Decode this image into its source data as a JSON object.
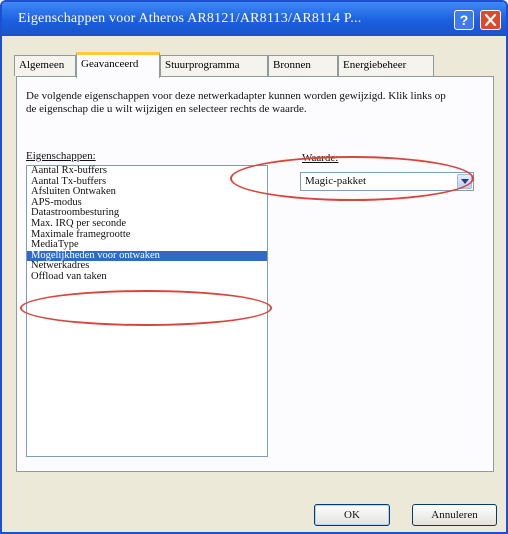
{
  "window": {
    "title": "Eigenschappen voor Atheros AR8121/AR8113/AR8114 P...",
    "help_glyph": "?",
    "close_icon": "close-icon"
  },
  "tabs": [
    {
      "label": "Algemeen",
      "active": false
    },
    {
      "label": "Geavanceerd",
      "active": true
    },
    {
      "label": "Stuurprogramma",
      "active": false
    },
    {
      "label": "Bronnen",
      "active": false
    },
    {
      "label": "Energiebeheer",
      "active": false
    }
  ],
  "advanced": {
    "description": "De volgende eigenschappen voor deze netwerkadapter kunnen worden gewijzigd. Klik links op de eigenschap die u wilt wijzigen en selecteer rechts de waarde.",
    "properties_label": "Eigenschappen:",
    "value_label": "Waarde:",
    "properties": [
      "Aantal Rx-buffers",
      "Aantal Tx-buffers",
      "Afsluiten Ontwaken",
      "APS-modus",
      "Datastroombesturing",
      "Max. IRQ per seconde",
      "Maximale framegrootte",
      "MediaType",
      "Mogelijkheden voor ontwaken",
      "Netwerkadres",
      "Offload van taken"
    ],
    "selected_index": 8,
    "selected_value": "Magic-pakket"
  },
  "buttons": {
    "ok": "OK",
    "cancel": "Annuleren"
  },
  "colors": {
    "title_bar": "#1b5fe0",
    "selection": "#316ac5",
    "annotation": "#d9453c",
    "tab_accent": "#ffc83c"
  }
}
